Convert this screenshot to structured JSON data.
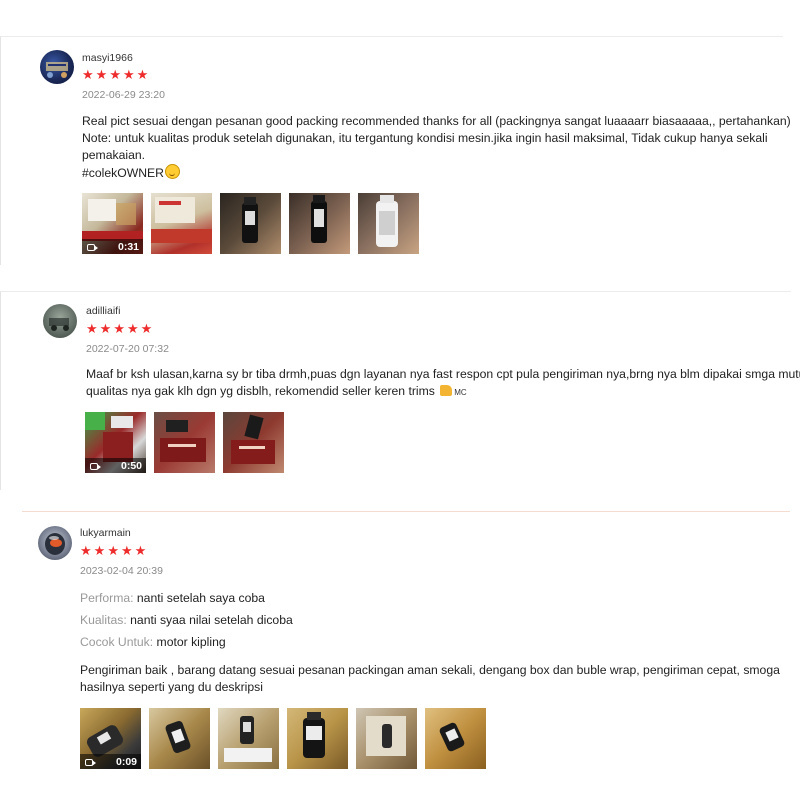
{
  "reviews": [
    {
      "username": "masyi1966",
      "stars": [
        "★",
        "★",
        "★",
        "★",
        "★"
      ],
      "date": "2022-06-29 23:20",
      "lines": [
        "Real pict sesuai dengan pesanan good packing recommended thanks for all (packingnya sangat luaaaarr biasaaaaa,, pertahankan)",
        "Note: untuk kualitas produk setelah digunakan, itu tergantung kondisi mesin.jika ingin hasil maksimal, Tidak cukup hanya sekali",
        "pemakaian.",
        "#colekOWNER"
      ],
      "video_duration": "0:31",
      "media_count": 5
    },
    {
      "username": "adilliaifi",
      "stars": [
        "★",
        "★",
        "★",
        "★",
        "★"
      ],
      "date": "2022-07-20 07:32",
      "lines": [
        "Maaf br ksh ulasan,karna sy br tiba drmh,puas dgn layanan nya fast respon cpt pula pengiriman nya,brng nya blm dipakai smga mutu",
        "qualitas nya gak klh dgn yg disblh, rekomendid seller keren trims"
      ],
      "suffix": "MC",
      "video_duration": "0:50",
      "media_count": 3
    },
    {
      "username": "lukyarmain",
      "stars": [
        "★",
        "★",
        "★",
        "★",
        "★"
      ],
      "date": "2023-02-04 20:39",
      "attributes": [
        {
          "label": "Performa:",
          "value": "nanti setelah saya coba"
        },
        {
          "label": "Kualitas:",
          "value": "nanti syaa nilai setelah dicoba"
        },
        {
          "label": "Cocok Untuk:",
          "value": "motor kipling"
        }
      ],
      "lines": [
        "Pengiriman baik , barang datang sesuai pesanan packingan aman sekali, dengang box dan buble wrap, pengiriman cepat, smoga",
        "hasilnya seperti yang du deskripsi"
      ],
      "video_duration": "0:09",
      "media_count": 6
    }
  ],
  "colors": {
    "star": "#ee2c2c",
    "date": "#8a8a8a",
    "attribute_label": "#999999"
  },
  "icons": [
    "video-camera-icon",
    "smile-emoji-icon",
    "thumbs-up-emoji-icon",
    "star-icon"
  ]
}
